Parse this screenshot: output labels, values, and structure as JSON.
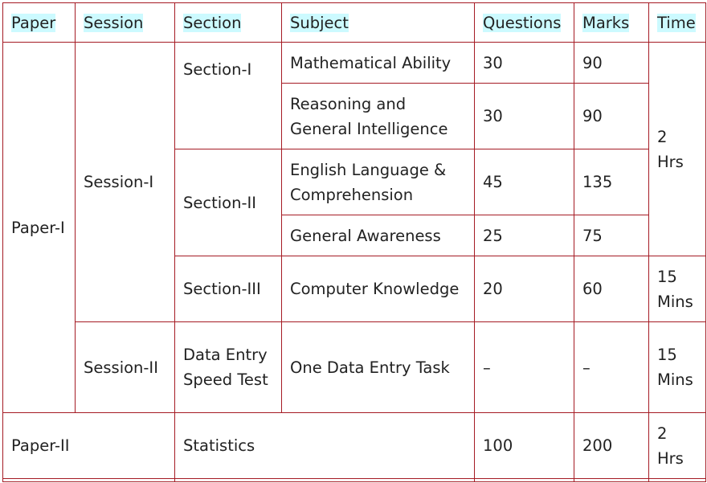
{
  "table": {
    "headers": [
      "Paper",
      "Session",
      "Section",
      "Subject",
      "Questions",
      "Marks",
      "Time"
    ],
    "header_highlight_color": "#ccfaff",
    "border_color": "#a51b24",
    "paper1": {
      "paper": "Paper-I",
      "session1": {
        "label": "Session-I",
        "time_main": "2 Hrs",
        "section1": {
          "label": "Section-I",
          "rows": [
            {
              "subject": "Mathematical Ability",
              "questions": "30",
              "marks": "90"
            },
            {
              "subject": "Reasoning and General Intelligence",
              "questions": "30",
              "marks": "90"
            }
          ]
        },
        "section2": {
          "label": "Section-II",
          "rows": [
            {
              "subject": "English Language & Comprehension",
              "questions": "45",
              "marks": "135"
            },
            {
              "subject": "General Awareness",
              "questions": "25",
              "marks": "75"
            }
          ]
        },
        "section3": {
          "label": "Section-III",
          "rows": [
            {
              "subject": "Computer Knowledge",
              "questions": "20",
              "marks": "60",
              "time": "15 Mins"
            }
          ]
        }
      },
      "session2": {
        "label": "Session-II",
        "section": "Data Entry Speed Test",
        "subject": "One Data Entry Task",
        "questions": "–",
        "marks": "–",
        "time": "15 Mins"
      }
    },
    "paper2": {
      "paper": "Paper-II",
      "subject": "Statistics",
      "questions": "100",
      "marks": "200",
      "time": "2 Hrs"
    }
  }
}
